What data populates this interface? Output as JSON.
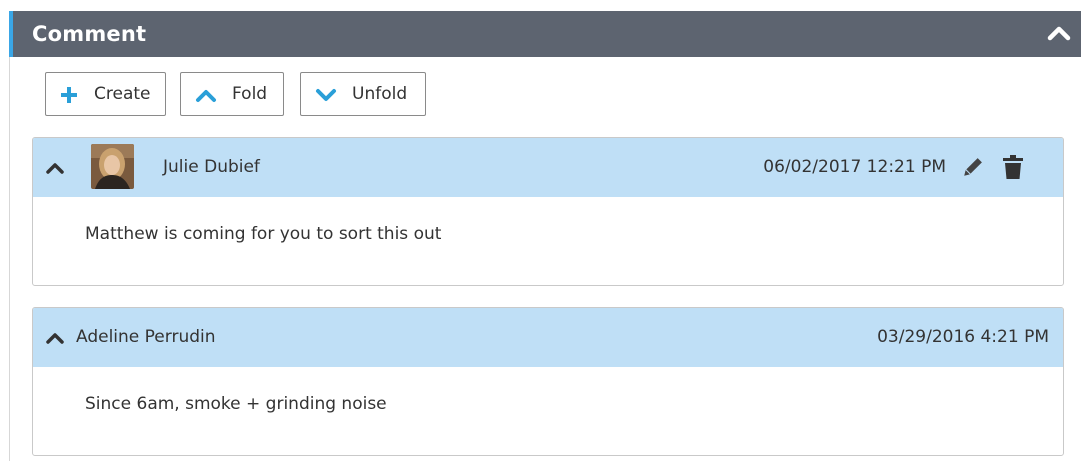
{
  "panel": {
    "title": "Comment",
    "collapse_icon": "chevron-up-icon",
    "header_color": "#5d6470",
    "accent_color": "#3aa6e6"
  },
  "toolbar": {
    "create_label": "Create",
    "fold_label": "Fold",
    "unfold_label": "Unfold",
    "create_icon": "plus-icon",
    "fold_icon": "chevron-up-icon",
    "unfold_icon": "chevron-down-icon"
  },
  "comments": [
    {
      "author": "Julie Dubief",
      "date": "06/02/2017 12:21 PM",
      "text": "Matthew is coming for you to sort this out",
      "has_avatar": true,
      "actions": [
        "pencil-icon",
        "trash-icon"
      ]
    },
    {
      "author": "Adeline Perrudin",
      "date": "03/29/2016 4:21 PM",
      "text": "Since 6am, smoke + grinding noise",
      "has_avatar": false,
      "actions": []
    }
  ],
  "colors": {
    "comment_header": "#bfdff6",
    "icon_blue": "#2a9fd8"
  }
}
